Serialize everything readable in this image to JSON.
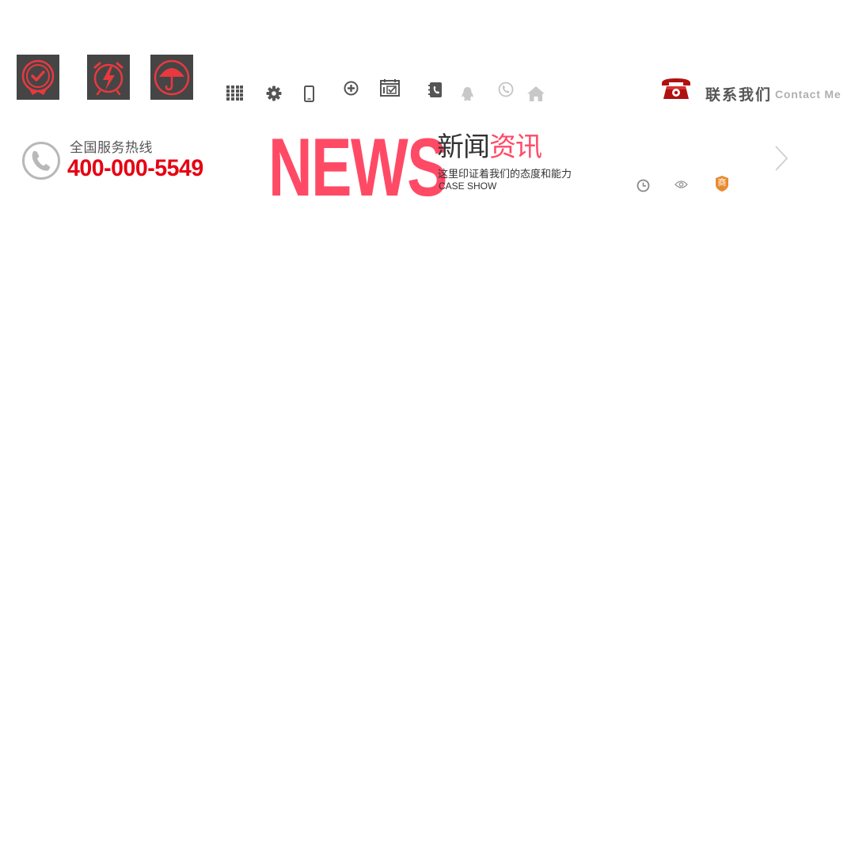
{
  "feature_icons": [
    {
      "name": "quality-badge-icon"
    },
    {
      "name": "alarm-clock-lightning-icon"
    },
    {
      "name": "umbrella-icon"
    }
  ],
  "toolbar_icons": [
    "grid-icon",
    "gear-icon",
    "mobile-phone-icon",
    "plus-circle-icon",
    "calendar-check-icon",
    "address-book-icon",
    "qq-penguin-icon",
    "phone-circle-icon",
    "home-icon"
  ],
  "contact": {
    "cn": "联系我们",
    "en": "Contact Me",
    "icon": "red-telephone-icon"
  },
  "hotline": {
    "label": "全国服务热线",
    "number": "400-000-5549",
    "icon": "phone-circle-icon"
  },
  "news": {
    "big_word": "NEWS",
    "title_dark": "新闻",
    "title_red": "资讯",
    "subtitle": "这里印证着我们的态度和能力",
    "english": "CASE SHOW"
  },
  "meta_icons": [
    "clock-icon",
    "eye-icon",
    "shop-badge-icon"
  ],
  "shop_badge_char": "商",
  "next_icon": "chevron-right-icon",
  "colors": {
    "accent_red": "#e60012",
    "news_pink": "#ff4a66",
    "icon_bg": "#454545",
    "icon_red": "#e8393f",
    "gray": "#888888"
  }
}
